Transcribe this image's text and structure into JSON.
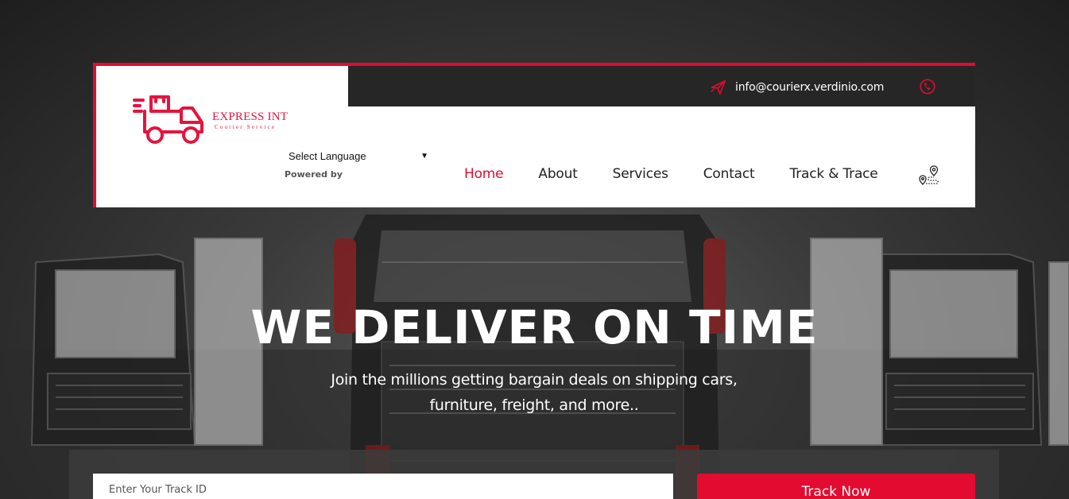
{
  "header": {
    "email": "info@courierx.verdinio.com",
    "logo_title": "EXPRESS INT",
    "logo_subtitle": "Courier Service",
    "language_select": "Select Language",
    "powered_by": "Powered by",
    "nav": [
      {
        "label": "Home",
        "active": true
      },
      {
        "label": "About",
        "active": false
      },
      {
        "label": "Services",
        "active": false
      },
      {
        "label": "Contact",
        "active": false
      },
      {
        "label": "Track & Trace",
        "active": false
      }
    ]
  },
  "hero": {
    "title": "WE DELIVER ON TIME",
    "subtitle_line1": "Join the millions getting bargain deals on shipping cars,",
    "subtitle_line2": "furniture, freight, and more.."
  },
  "track": {
    "placeholder": "Enter Your Track ID",
    "button": "Track Now"
  },
  "colors": {
    "accent": "#e30b2f",
    "topbar": "#262626"
  },
  "icons": [
    "send-icon",
    "phone-icon",
    "delivery-truck-logo-icon",
    "map-pin-icon"
  ]
}
